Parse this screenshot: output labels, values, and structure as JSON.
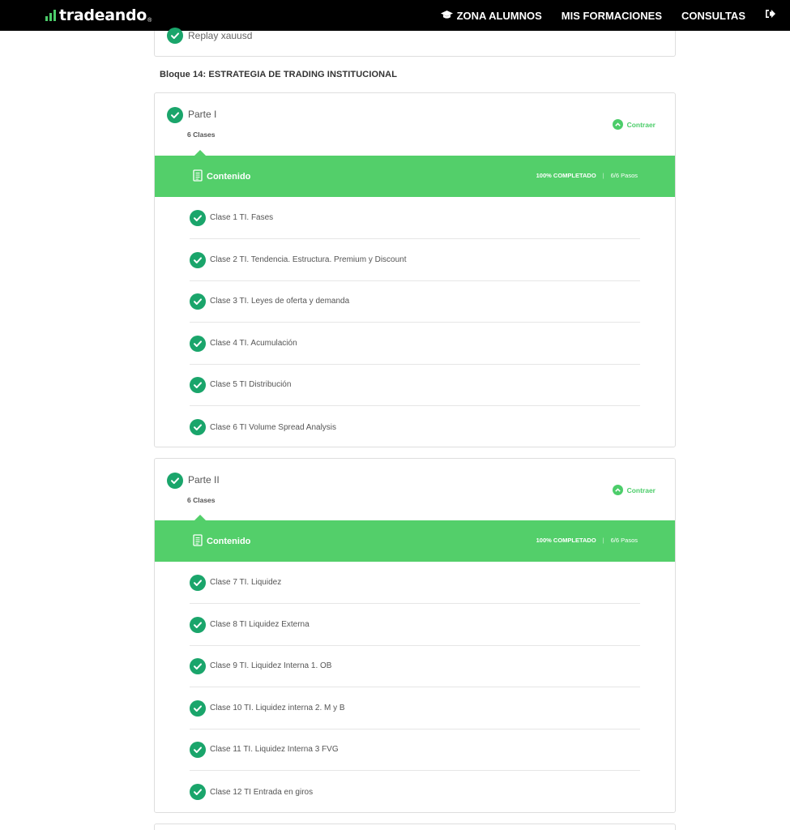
{
  "nav": {
    "logo_text": "tradeando",
    "logo_reg": "®",
    "items": [
      {
        "label": "ZONA ALUMNOS"
      },
      {
        "label": "MIS FORMACIONES"
      },
      {
        "label": "CONSULTAS"
      }
    ]
  },
  "previous": {
    "label": "Replay xauusd"
  },
  "block": {
    "title": "Bloque 14: ESTRATEGIA DE TRADING INSTITUCIONAL"
  },
  "parts": [
    {
      "title": "Parte I",
      "count": "6 Clases",
      "toggle": "Contraer",
      "content_label": "Contenido",
      "progress": "100% COMPLETADO",
      "steps": "6/6 Pasos",
      "lessons": [
        "Clase 1 TI. Fases",
        "Clase 2 TI. Tendencia. Estructura. Premium y Discount",
        "Clase 3 TI. Leyes de oferta y demanda",
        "Clase 4 TI. Acumulación",
        "Clase 5 TI Distribución",
        "Clase 6 TI Volume Spread Analysis"
      ]
    },
    {
      "title": "Parte II",
      "count": "6 Clases",
      "toggle": "Contraer",
      "content_label": "Contenido",
      "progress": "100% COMPLETADO",
      "steps": "6/6 Pasos",
      "lessons": [
        "Clase 7 TI. Liquidez",
        "Clase 8 TI Liquidez Externa",
        "Clase 9 TI. Liquidez Interna 1. OB",
        "Clase 10 TI. Liquidez interna 2. M y B",
        "Clase 11 TI. Liquidez Interna 3 FVG",
        "Clase 12 TI Entrada en giros"
      ]
    }
  ],
  "colors": {
    "accent": "#53cf6a",
    "check": "#1aa56b",
    "nav_bg": "#000000"
  },
  "icons": [
    "logo-bars-icon",
    "graduation-cap-icon",
    "logout-icon",
    "check-icon",
    "chevron-up-icon",
    "document-icon"
  ]
}
